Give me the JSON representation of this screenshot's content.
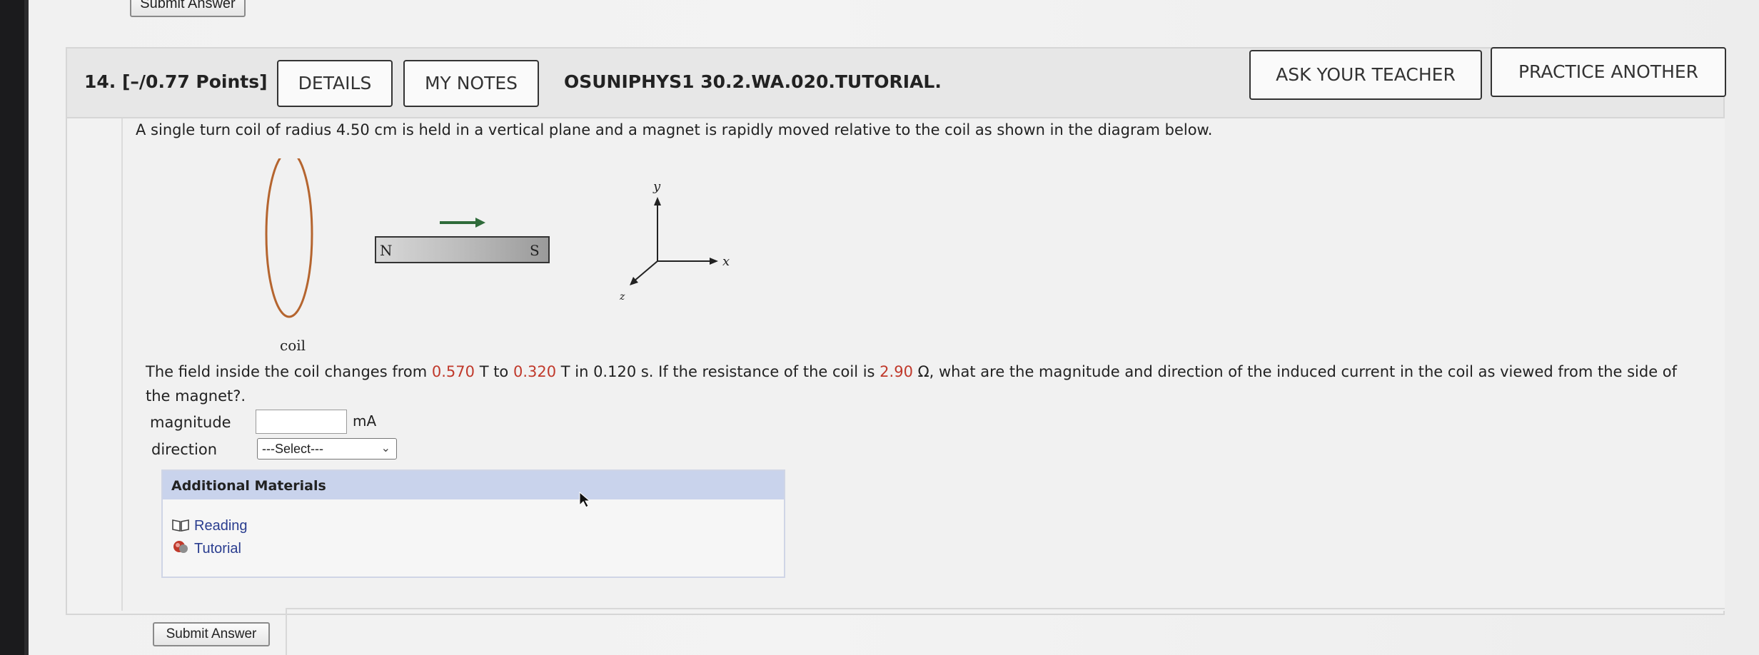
{
  "top": {
    "submit_label": "Submit Answer"
  },
  "question": {
    "number_points": "14. [–/0.77 Points]",
    "details_label": "DETAILS",
    "notes_label": "MY NOTES",
    "code": "OSUNIPHYS1 30.2.WA.020.TUTORIAL.",
    "ask_label": "ASK YOUR TEACHER",
    "practice_label": "PRACTICE ANOTHER"
  },
  "problem": {
    "intro": "A single turn coil of radius 4.50 cm is held in a vertical plane and a magnet is rapidly moved relative to the coil as shown in the diagram below.",
    "text_a": "The field inside the coil changes from ",
    "b1": "0.570",
    "text_b": " T to ",
    "b2": "0.320",
    "text_c": " T in 0.120 s. If the resistance of the coil is ",
    "r": "2.90",
    "text_d": " Ω, what are the magnitude and direction of the induced current in the coil as viewed from the side of the magnet?."
  },
  "diagram": {
    "coil_label": "coil",
    "north_label": "N",
    "south_label": "S",
    "axis_x": "x",
    "axis_y": "y",
    "axis_z": "z",
    "coil_color": "#b5652f",
    "arrow_color": "#2f6b3a"
  },
  "form": {
    "magnitude_label": "magnitude",
    "magnitude_value": "",
    "unit": "mA",
    "direction_label": "direction",
    "direction_selected": "---Select---"
  },
  "materials": {
    "title": "Additional Materials",
    "links": [
      {
        "label": "Reading",
        "icon": "book-icon"
      },
      {
        "label": "Tutorial",
        "icon": "tutorial-icon"
      }
    ]
  },
  "bottom": {
    "submit_label": "Submit Answer"
  }
}
